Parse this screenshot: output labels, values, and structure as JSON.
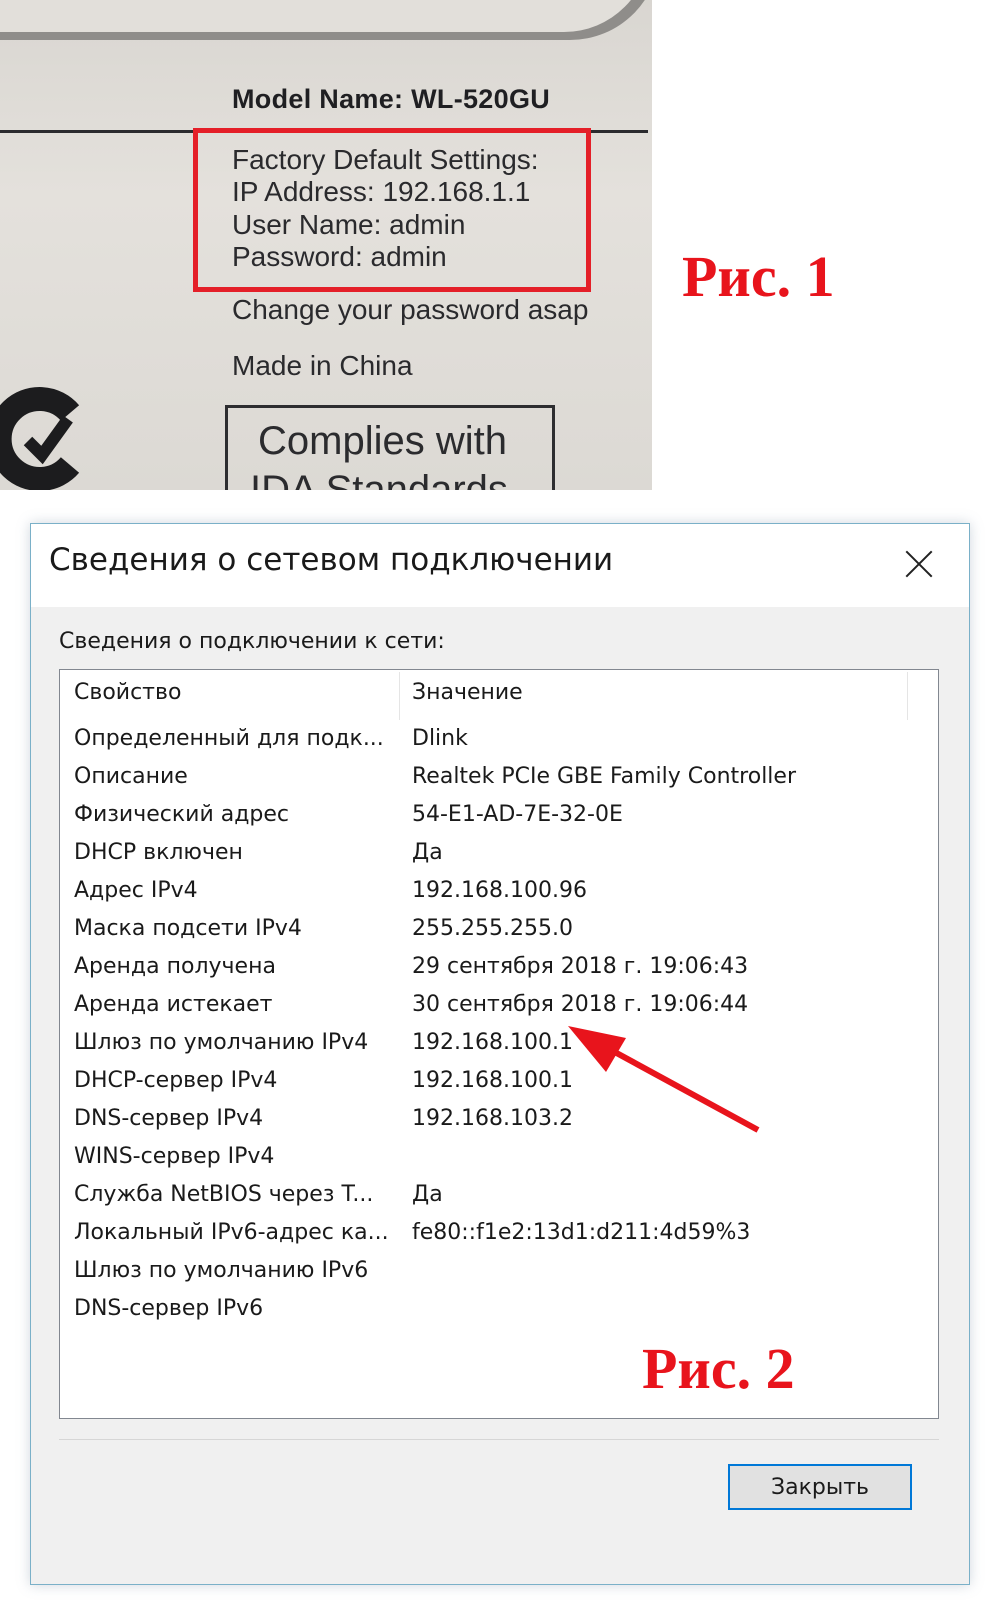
{
  "figure1": {
    "model_name": "Model Name: WL-520GU",
    "factory_defaults": [
      "Factory Default Settings:",
      "IP Address: 192.168.1.1",
      "User Name:  admin",
      "Password:  admin"
    ],
    "change_password": "Change your password asap",
    "made_in": "Made in China",
    "complies_line1": "Complies with",
    "complies_line2": "IDA Standards",
    "caption": "Рис. 1",
    "highlight_color": "#e41f28"
  },
  "dialog": {
    "title": "Сведения о сетевом подключении",
    "close_icon": "close-icon",
    "group_label": "Сведения о подключении к сети:",
    "columns": [
      "Свойство",
      "Значение"
    ],
    "rows": [
      [
        "Определенный для подк...",
        "Dlink"
      ],
      [
        "Описание",
        "Realtek PCIe GBE Family Controller"
      ],
      [
        "Физический адрес",
        "54-E1-AD-7E-32-0E"
      ],
      [
        "DHCP включен",
        "Да"
      ],
      [
        "Адрес IPv4",
        "192.168.100.96"
      ],
      [
        "Маска подсети IPv4",
        "255.255.255.0"
      ],
      [
        "Аренда получена",
        "29 сентября 2018 г. 19:06:43"
      ],
      [
        "Аренда истекает",
        "30 сентября 2018 г. 19:06:44"
      ],
      [
        "Шлюз по умолчанию IPv4",
        "192.168.100.1"
      ],
      [
        "DHCP-сервер IPv4",
        "192.168.100.1"
      ],
      [
        "DNS-сервер IPv4",
        "192.168.103.2"
      ],
      [
        "WINS-сервер IPv4",
        ""
      ],
      [
        "Служба NetBIOS через T...",
        "Да"
      ],
      [
        "Локальный IPv6-адрес ка...",
        "fe80::f1e2:13d1:d211:4d59%3"
      ],
      [
        "Шлюз по умолчанию IPv6",
        ""
      ],
      [
        "DNS-сервер IPv6",
        ""
      ]
    ],
    "close_button": "Закрыть",
    "caption": "Рис. 2",
    "arrow_color": "#e8141c"
  }
}
